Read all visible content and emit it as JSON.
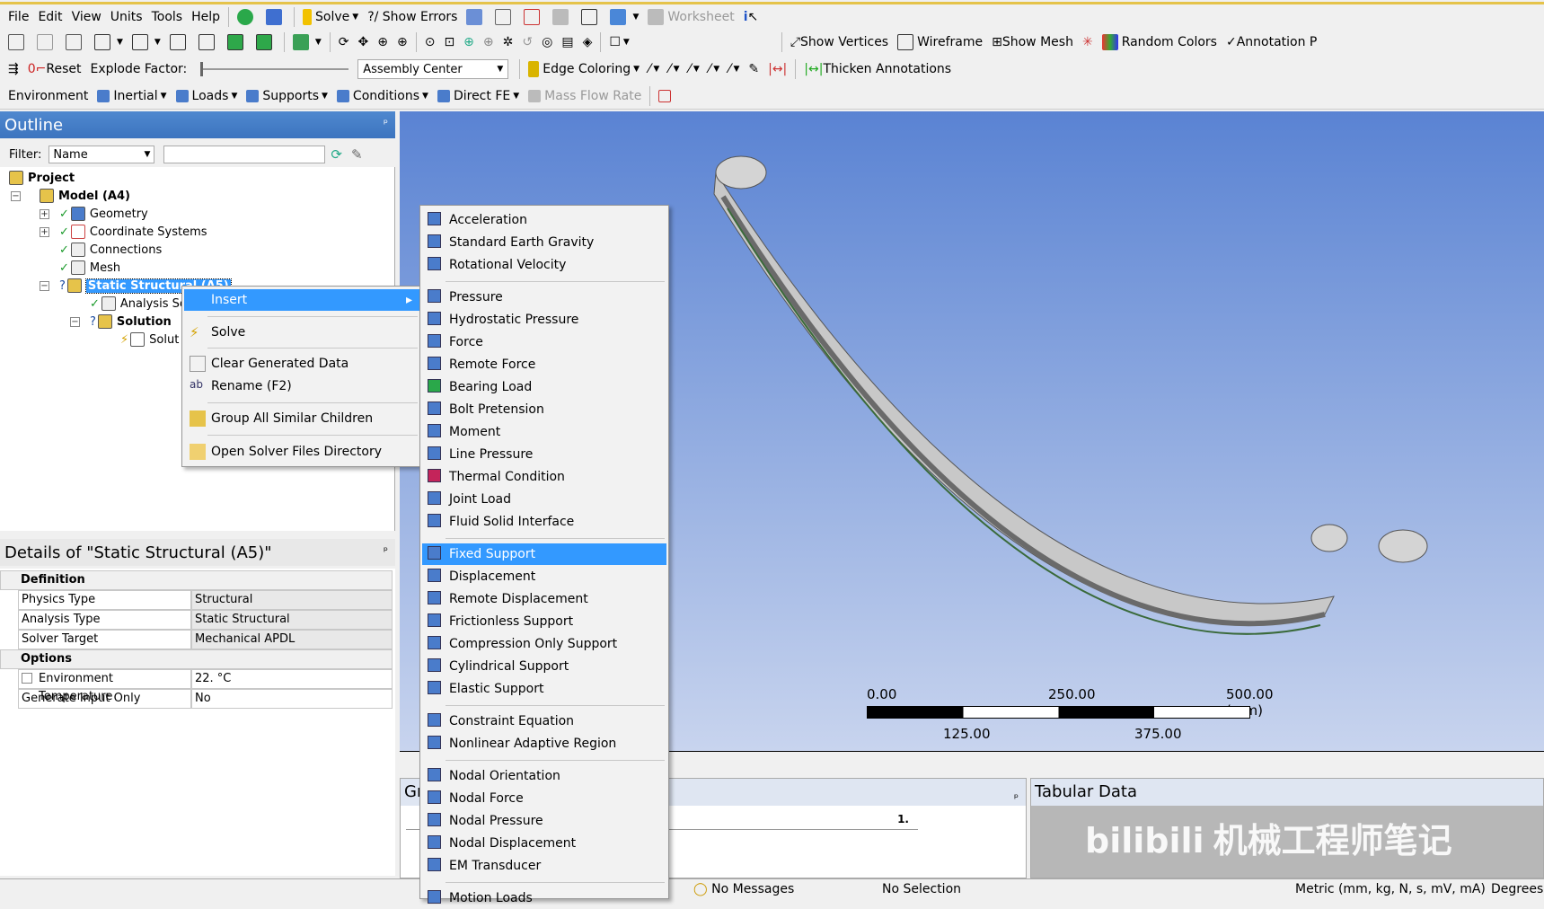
{
  "menubar": {
    "items": [
      "File",
      "Edit",
      "View",
      "Units",
      "Tools",
      "Help"
    ],
    "solve": "Solve",
    "show_errors": "?/ Show Errors",
    "worksheet": "Worksheet"
  },
  "toolbar2": {
    "show_vertices": "Show Vertices",
    "wireframe": "Wireframe",
    "show_mesh": "Show Mesh",
    "random_colors": "Random Colors",
    "annotation": "Annotation P"
  },
  "toolbar3": {
    "reset": "Reset",
    "explode_factor": "Explode Factor:",
    "assembly_center": "Assembly Center",
    "edge_coloring": "Edge Coloring",
    "thicken_annotations": "Thicken Annotations"
  },
  "toolbar4": {
    "environment": "Environment",
    "inertial": "Inertial",
    "loads": "Loads",
    "supports": "Supports",
    "conditions": "Conditions",
    "direct_fe": "Direct FE",
    "mass_flow_rate": "Mass Flow Rate"
  },
  "outline": {
    "title": "Outline",
    "filter_label": "Filter:",
    "filter_value": "Name",
    "nodes": [
      "Project",
      "Model (A4)",
      "Geometry",
      "Coordinate Systems",
      "Connections",
      "Mesh",
      "Static Structural (A5)",
      "Analysis Se",
      "Solution",
      "Solut"
    ]
  },
  "context_menu": {
    "items": [
      "Insert",
      "Solve",
      "Clear Generated Data",
      "Rename (F2)",
      "Group All Similar Children",
      "Open Solver Files Directory"
    ]
  },
  "insert_menu": {
    "items": [
      "Acceleration",
      "Standard Earth Gravity",
      "Rotational Velocity",
      "Pressure",
      "Hydrostatic Pressure",
      "Force",
      "Remote Force",
      "Bearing Load",
      "Bolt Pretension",
      "Moment",
      "Line Pressure",
      "Thermal Condition",
      "Joint Load",
      "Fluid Solid Interface",
      "Fixed Support",
      "Displacement",
      "Remote Displacement",
      "Frictionless Support",
      "Compression Only Support",
      "Cylindrical Support",
      "Elastic Support",
      "Constraint Equation",
      "Nonlinear Adaptive Region",
      "Nodal Orientation",
      "Nodal Force",
      "Nodal Pressure",
      "Nodal Displacement",
      "EM Transducer",
      "Motion Loads"
    ],
    "highlighted": "Fixed Support"
  },
  "details": {
    "title": "Details of \"Static Structural (A5)\"",
    "sections": [
      {
        "name": "Definition",
        "rows": [
          [
            "Physics Type",
            "Structural"
          ],
          [
            "Analysis Type",
            "Static Structural"
          ],
          [
            "Solver Target",
            "Mechanical APDL"
          ]
        ]
      },
      {
        "name": "Options",
        "rows": [
          [
            "Environment Temperature",
            "22. °C"
          ],
          [
            "Generate Input Only",
            "No"
          ]
        ]
      }
    ]
  },
  "scale": {
    "top": [
      "0.00",
      "250.00",
      "500.00 (mm)"
    ],
    "bottom": [
      "125.00",
      "375.00"
    ]
  },
  "graph": {
    "title": "Gr",
    "value": "1."
  },
  "tabular": {
    "title": "Tabular Data"
  },
  "status": {
    "messages": "No Messages",
    "selection": "No Selection",
    "units": "Metric (mm, kg, N, s, mV, mA)",
    "angle": "Degrees"
  },
  "watermark": "机械工程师笔记",
  "colors": {
    "header": "#3c74bf",
    "highlight": "#3399ff",
    "viewport_top": "#5a83d3"
  }
}
